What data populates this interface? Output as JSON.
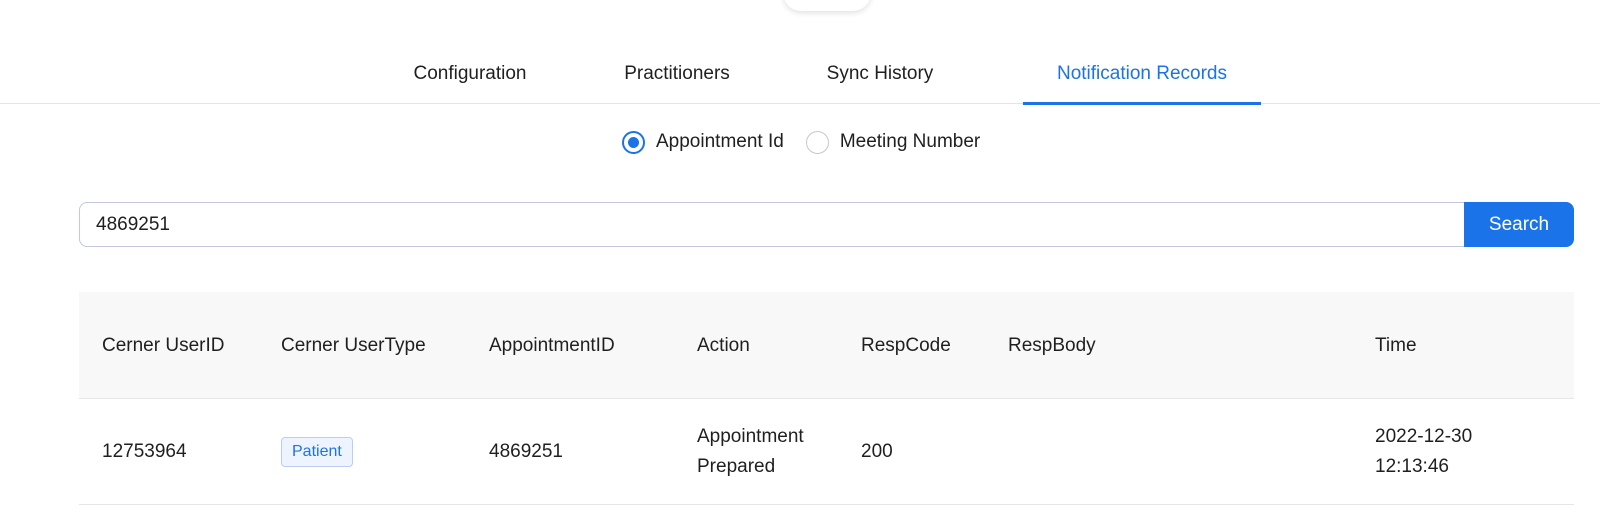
{
  "tabs": [
    {
      "label": "Configuration",
      "active": false
    },
    {
      "label": "Practitioners",
      "active": false
    },
    {
      "label": "Sync History",
      "active": false
    },
    {
      "label": "Notification Records",
      "active": true
    }
  ],
  "filter": {
    "options": [
      {
        "label": "Appointment Id",
        "selected": true
      },
      {
        "label": "Meeting Number",
        "selected": false
      }
    ]
  },
  "search": {
    "value": "4869251",
    "button_label": "Search"
  },
  "table": {
    "headers": {
      "user_id": "Cerner UserID",
      "user_type": "Cerner UserType",
      "appointment_id": "AppointmentID",
      "action": "Action",
      "resp_code": "RespCode",
      "resp_body": "RespBody",
      "time": "Time"
    },
    "rows": [
      {
        "user_id": "12753964",
        "user_type": "Patient",
        "appointment_id": "4869251",
        "action": "Appointment Prepared",
        "resp_code": "200",
        "resp_body": "",
        "time": "2022-12-30 12:13:46"
      }
    ]
  },
  "colors": {
    "accent": "#1a73e8",
    "header_bg": "#f8f8f8",
    "badge_bg": "#eef4ff"
  }
}
